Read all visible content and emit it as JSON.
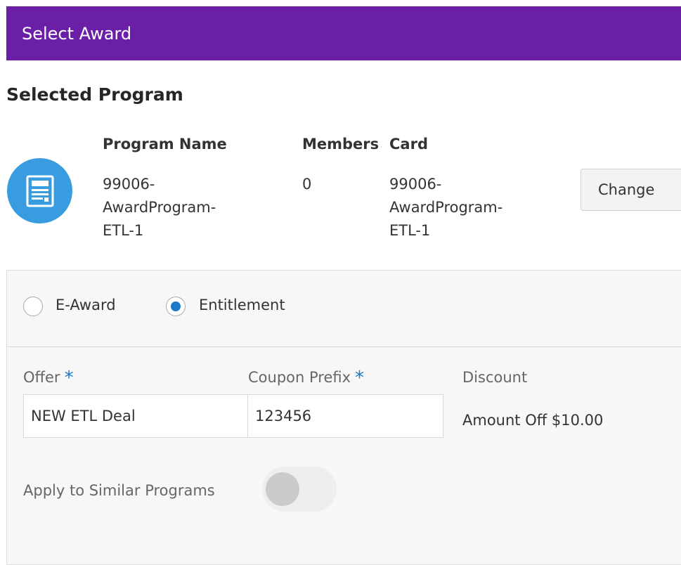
{
  "header": {
    "title": "Select Award"
  },
  "selected_program": {
    "title": "Selected Program",
    "columns": {
      "program_name": "Program Name",
      "members": "Members",
      "card": "Card"
    },
    "program_name": [
      "99006-",
      "AwardProgram-",
      "ETL-1"
    ],
    "members": "0",
    "card": [
      "99006-",
      "AwardProgram-",
      "ETL-1"
    ],
    "change_label": "Change",
    "icon": "program-card-icon",
    "icon_color": "#3a9ce0"
  },
  "award_type": {
    "options": [
      {
        "label": "E-Award",
        "selected": false
      },
      {
        "label": "Entitlement",
        "selected": true
      }
    ]
  },
  "form": {
    "offer_label": "Offer",
    "offer_value": "NEW ETL Deal",
    "coupon_prefix_label": "Coupon Prefix",
    "coupon_prefix_value": "123456",
    "required_marker": "*",
    "discount_label": "Discount",
    "discount_value": "Amount Off $10.00",
    "apply_similar_label": "Apply to Similar Programs",
    "apply_similar_enabled": false
  },
  "colors": {
    "header_bg": "#6a1fa6",
    "accent": "#1a7ac9"
  }
}
